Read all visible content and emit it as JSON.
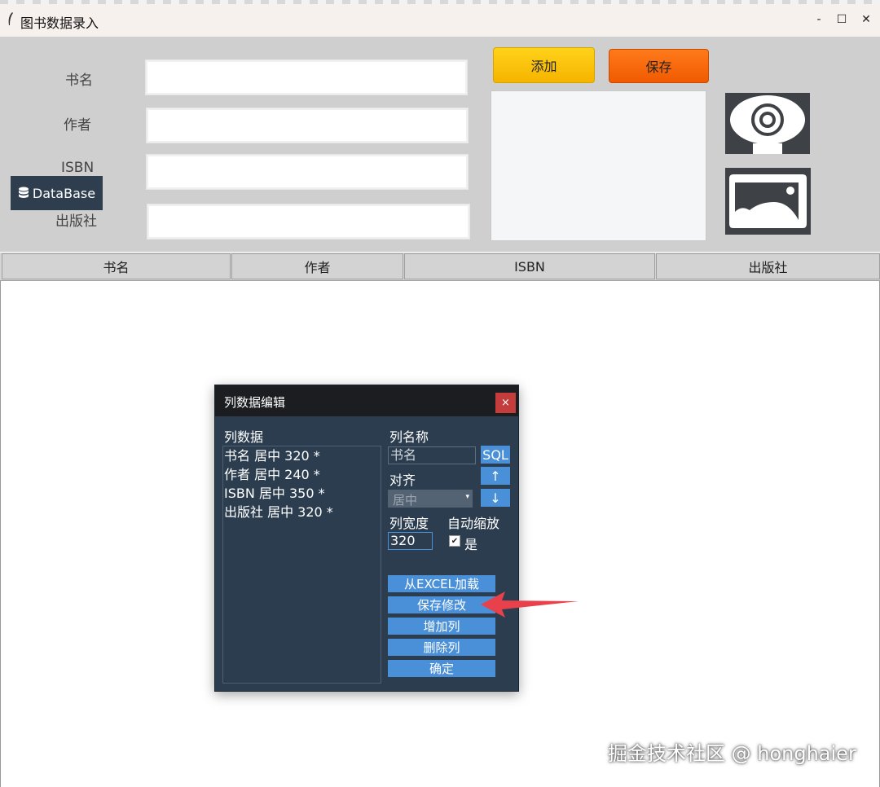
{
  "window": {
    "title": "图书数据录入",
    "minimize": "-",
    "maximize": "☐",
    "close": "✕"
  },
  "form": {
    "labels": {
      "book_name": "书名",
      "author": "作者",
      "isbn": "ISBN",
      "publisher": "出版社"
    },
    "values": {
      "book_name": "",
      "author": "",
      "isbn": "",
      "publisher": ""
    },
    "add_button": "添加",
    "save_button": "保存",
    "database_badge": "DataBase"
  },
  "icons": {
    "camera": "webcam-icon",
    "image": "image-icon",
    "database": "database-icon"
  },
  "table": {
    "columns": [
      "书名",
      "作者",
      "ISBN",
      "出版社"
    ]
  },
  "dialog": {
    "title": "列数据编辑",
    "close": "×",
    "column_data_label": "列数据",
    "column_list": [
      "书名 居中 320 *",
      "作者 居中 240 *",
      "ISBN 居中 350 *",
      "出版社 居中 320 *"
    ],
    "column_name_label": "列名称",
    "column_name_value": "书名",
    "sql_button": "SQL",
    "align_label": "对齐",
    "up_button": "↑",
    "down_button": "↓",
    "align_value": "居中",
    "width_label": "列宽度",
    "width_value": "320",
    "auto_scale_label": "自动缩放",
    "auto_scale_checked": "✔",
    "auto_scale_yes": "是",
    "load_excel_button": "从EXCEL加载",
    "save_changes_button": "保存修改",
    "add_column_button": "增加列",
    "delete_column_button": "删除列",
    "ok_button": "确定"
  },
  "watermark": "掘金技术社区 @ honghaier",
  "colors": {
    "accent_yellow": "#f5b400",
    "accent_orange": "#f05a00",
    "dialog_bg": "#2c3d50",
    "dialog_button": "#4a90d9",
    "arrow": "#e8414b"
  }
}
